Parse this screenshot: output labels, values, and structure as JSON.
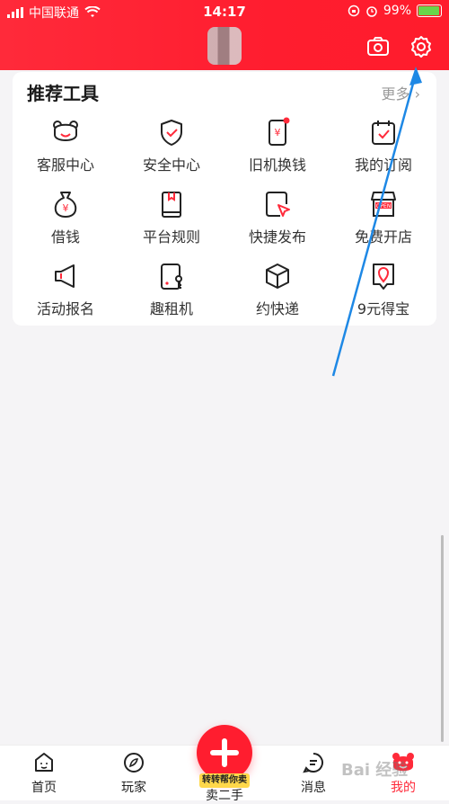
{
  "status_bar": {
    "carrier": "中国联通",
    "time": "14:17",
    "battery": "99%",
    "battery_level": 0.99
  },
  "header": {
    "camera_icon": "camera-icon",
    "settings_icon": "gear-icon"
  },
  "tools_section": {
    "title": "推荐工具",
    "more": "更多",
    "items": [
      {
        "label": "客服中心",
        "icon": "bear-face-icon"
      },
      {
        "label": "安全中心",
        "icon": "shield-check-icon"
      },
      {
        "label": "旧机换钱",
        "icon": "phone-yen-icon"
      },
      {
        "label": "我的订阅",
        "icon": "calendar-check-icon"
      },
      {
        "label": "借钱",
        "icon": "money-bag-icon"
      },
      {
        "label": "平台规则",
        "icon": "book-bookmark-icon"
      },
      {
        "label": "快捷发布",
        "icon": "quick-post-icon"
      },
      {
        "label": "免费开店",
        "icon": "open-store-icon"
      },
      {
        "label": "活动报名",
        "icon": "megaphone-icon"
      },
      {
        "label": "趣租机",
        "icon": "rent-phone-icon"
      },
      {
        "label": "约快递",
        "icon": "box-icon"
      },
      {
        "label": "9元得宝",
        "icon": "map-pin-icon"
      }
    ]
  },
  "bottom_nav": {
    "items": [
      {
        "label": "首页",
        "icon": "home-face-icon"
      },
      {
        "label": "玩家",
        "icon": "compass-icon"
      },
      {
        "label": "卖二手",
        "icon": "plus-icon"
      },
      {
        "label": "消息",
        "icon": "message-icon"
      },
      {
        "label": "我的",
        "icon": "bear-icon"
      }
    ],
    "sell_badge": "转转帮你卖"
  },
  "colors": {
    "brand_red": "#ff1d2f",
    "annotation_blue": "#1e88e5"
  },
  "watermark": "Bai 经验"
}
